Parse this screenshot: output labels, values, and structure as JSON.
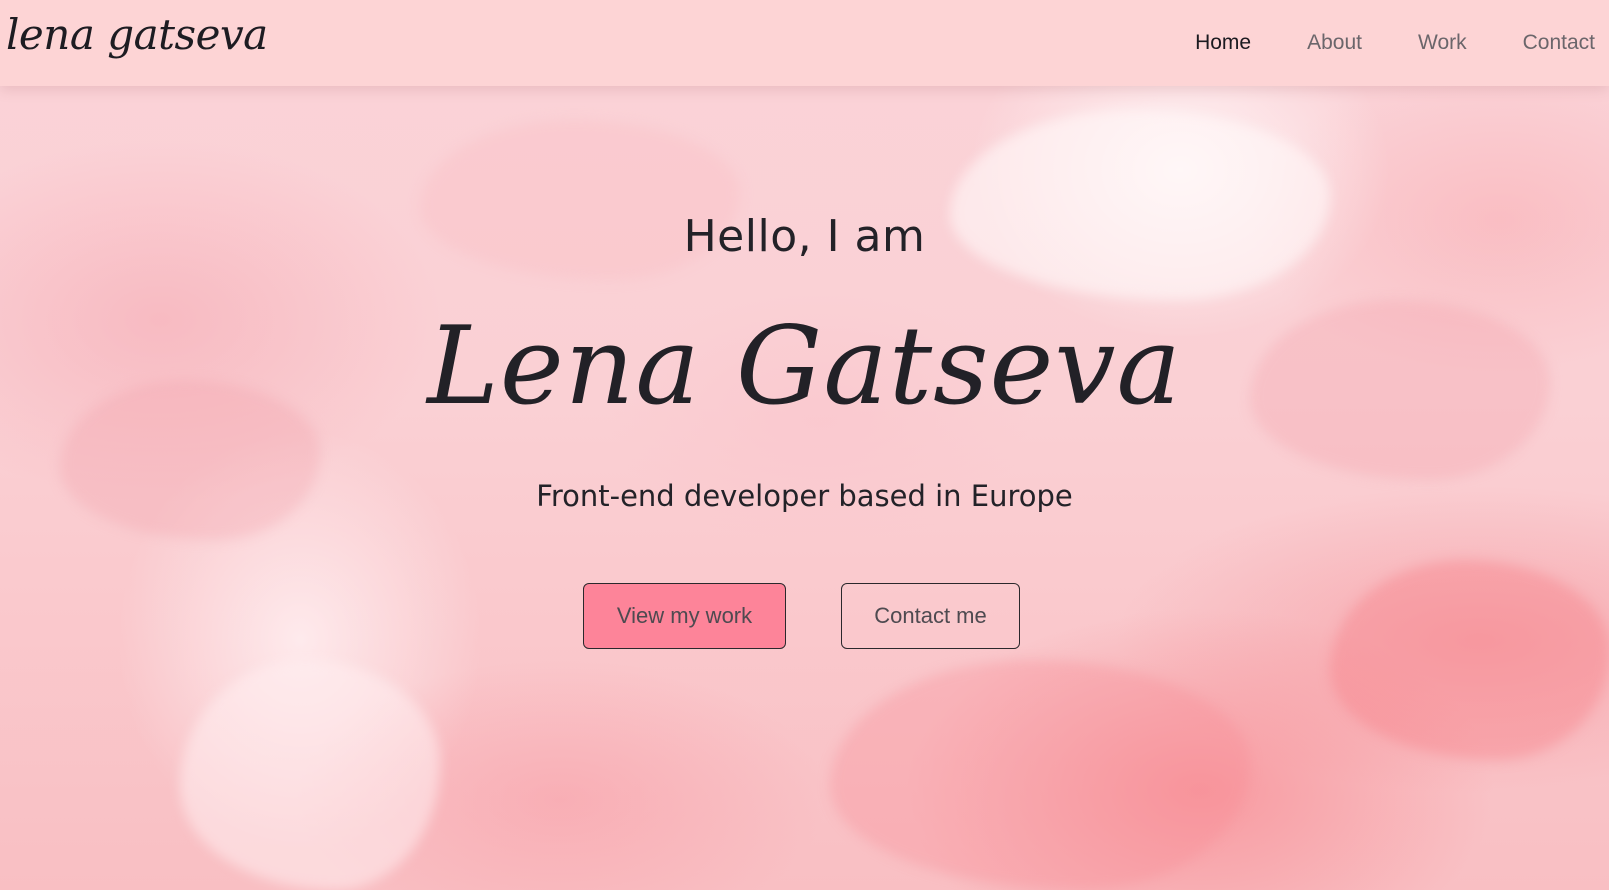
{
  "header": {
    "logo_text": "lena gatseva",
    "nav": [
      {
        "label": "Home",
        "active": true
      },
      {
        "label": "About",
        "active": false
      },
      {
        "label": "Work",
        "active": false
      },
      {
        "label": "Contact",
        "active": false
      }
    ]
  },
  "hero": {
    "greeting": "Hello, I am",
    "name": "Lena Gatseva",
    "tagline": "Front-end developer based in Europe",
    "primary_button": "View my work",
    "secondary_button": "Contact me"
  },
  "colors": {
    "navbar_bg": "#fdd4d5",
    "primary_button_bg": "#fd8499",
    "text_dark": "#232228",
    "nav_inactive": "#6b666b"
  }
}
